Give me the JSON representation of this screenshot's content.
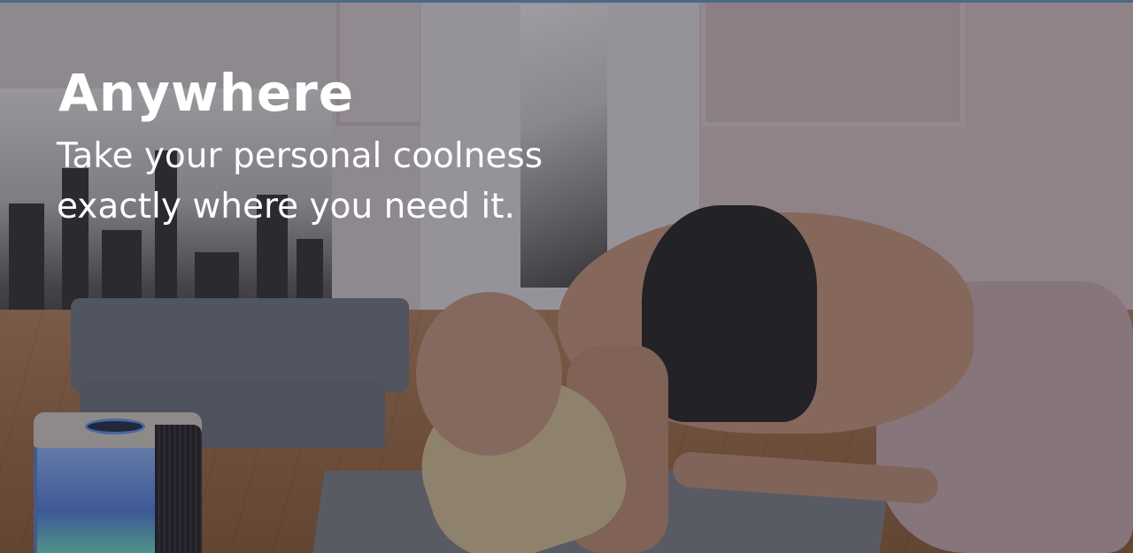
{
  "hero": {
    "title": "Anywhere",
    "subtitle_line1": "Take your personal coolness",
    "subtitle_line2": "exactly where you need it.",
    "image_description_icon": "photo-background"
  },
  "colors": {
    "text": "#ffffff",
    "overlay": "rgba(40,38,48,0.42)",
    "cooler_glow": "#5b7fd0"
  }
}
